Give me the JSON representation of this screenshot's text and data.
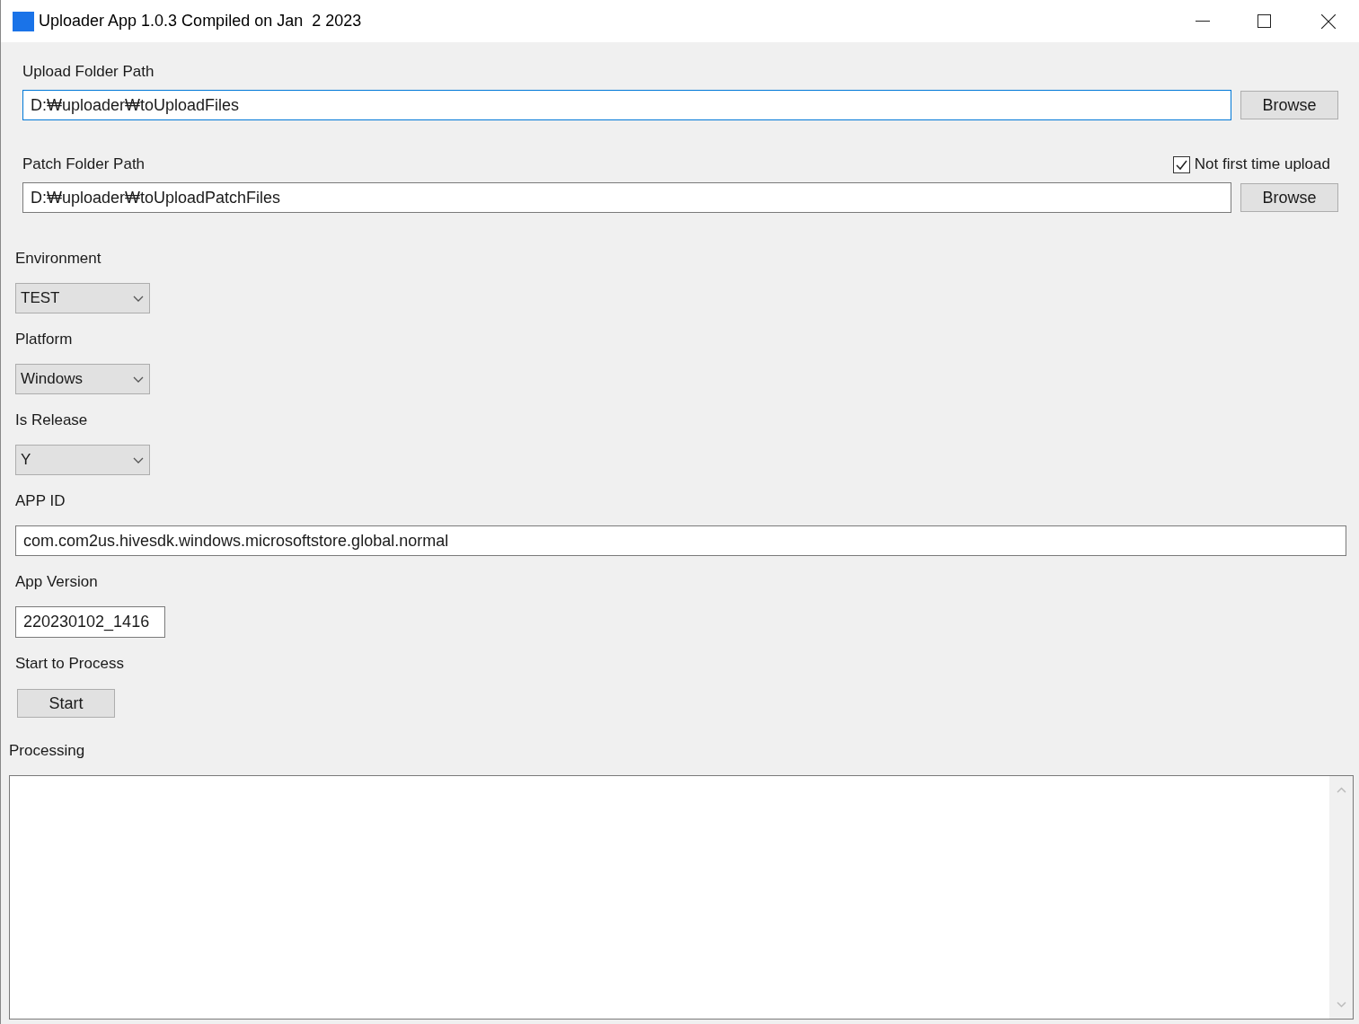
{
  "window": {
    "title": "Uploader App 1.0.3 Compiled on Jan  2 2023"
  },
  "upload_folder": {
    "label": "Upload Folder Path",
    "value": "D:₩uploader₩toUploadFiles",
    "focused": true,
    "button": "Browse"
  },
  "patch_folder": {
    "label": "Patch Folder Path",
    "value": "D:₩uploader₩toUploadPatchFiles",
    "focused": false,
    "button": "Browse",
    "checkbox": {
      "label": "Not first time upload",
      "checked": true
    }
  },
  "dropdowns": [
    {
      "label": "Environment",
      "value": "TEST"
    },
    {
      "label": "Platform",
      "value": "Windows"
    },
    {
      "label": "Is Release",
      "value": "Y"
    }
  ],
  "app_id": {
    "label": "APP ID",
    "value": "com.com2us.hivesdk.windows.microsoftstore.global.normal"
  },
  "app_version": {
    "label": "App Version",
    "value": "220230102_1416"
  },
  "start": {
    "label": "Start to Process",
    "button": "Start"
  },
  "processing": {
    "label": "Processing"
  }
}
